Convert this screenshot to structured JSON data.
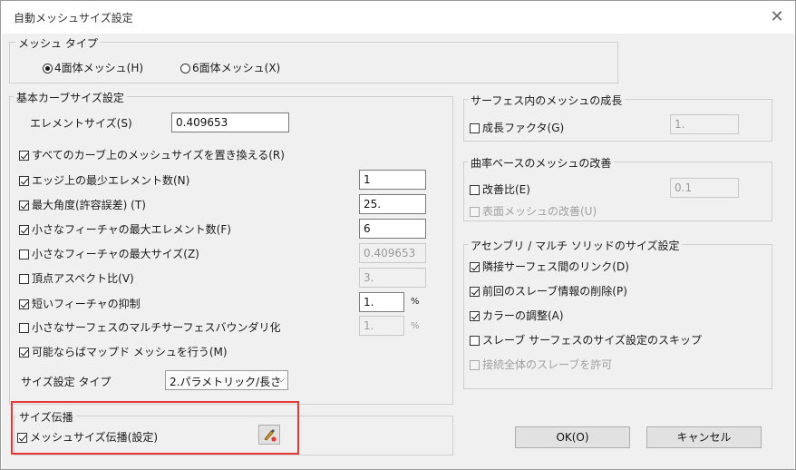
{
  "window": {
    "title": "自動メッシュサイズ設定",
    "close_glyph": "✕"
  },
  "mesh_type": {
    "label": "メッシュ タイプ",
    "options": [
      {
        "label": "4面体メッシュ(H)",
        "selected": true
      },
      {
        "label": "6面体メッシュ(X)",
        "selected": false
      }
    ]
  },
  "basic": {
    "label": "基本カーブサイズ設定",
    "element_size_label": "エレメントサイズ(S)",
    "element_size_value": "0.409653",
    "replace_all_label": "すべてのカーブ上のメッシュサイズを置き換える(R)",
    "min_elements_label": "エッジ上の最少エレメント数(N)",
    "min_elements_value": "1",
    "max_angle_label": "最大角度(許容誤差) (T)",
    "max_angle_value": "25.",
    "small_feat_max_elem_label": "小さなフィーチャの最大エレメント数(F)",
    "small_feat_max_elem_value": "6",
    "small_feat_max_size_label": "小さなフィーチャの最大サイズ(Z)",
    "small_feat_max_size_value": "0.409653",
    "vertex_aspect_label": "頂点アスペクト比(V)",
    "vertex_aspect_value": "3.",
    "suppress_short_label": "短いフィーチャの抑制",
    "suppress_short_value": "1.",
    "suppress_short_unit": "%",
    "small_surface_label": "小さなサーフェスのマルチサーフェスバウンダリ化",
    "small_surface_value": "1.",
    "small_surface_unit": "%",
    "mapped_mesh_label": "可能ならばマップド メッシュを行う(M)",
    "size_type_label": "サイズ設定 タイプ",
    "size_type_value": "2.パラメトリック/長さ"
  },
  "growth": {
    "label": "サーフェス内のメッシュの成長",
    "growth_factor_label": "成長ファクタ(G)",
    "growth_factor_value": "1."
  },
  "curvature": {
    "label": "曲率ベースのメッシュの改善",
    "improve_ratio_label": "改善比(E)",
    "improve_ratio_value": "0.1",
    "surface_improve_label": "表面メッシュの改善(U)"
  },
  "assembly": {
    "label": "アセンブリ / マルチ ソリッドのサイズ設定",
    "link_label": "隣接サーフェス間のリンク(D)",
    "delete_slave_label": "前回のスレーブ情報の削除(P)",
    "color_adjust_label": "カラーの調整(A)",
    "skip_slave_label": "スレーブ サーフェスのサイズ設定のスキップ",
    "allow_slave_label": "接続全体のスレーブを許可"
  },
  "propagation": {
    "label": "サイズ伝播",
    "mesh_prop_label": "メッシュサイズ伝播(設定)"
  },
  "buttons": {
    "ok": "OK(O)",
    "cancel": "キャンセル"
  },
  "colors": {
    "highlight": "#e53935",
    "dialog_bg": "#f0f0f0"
  }
}
